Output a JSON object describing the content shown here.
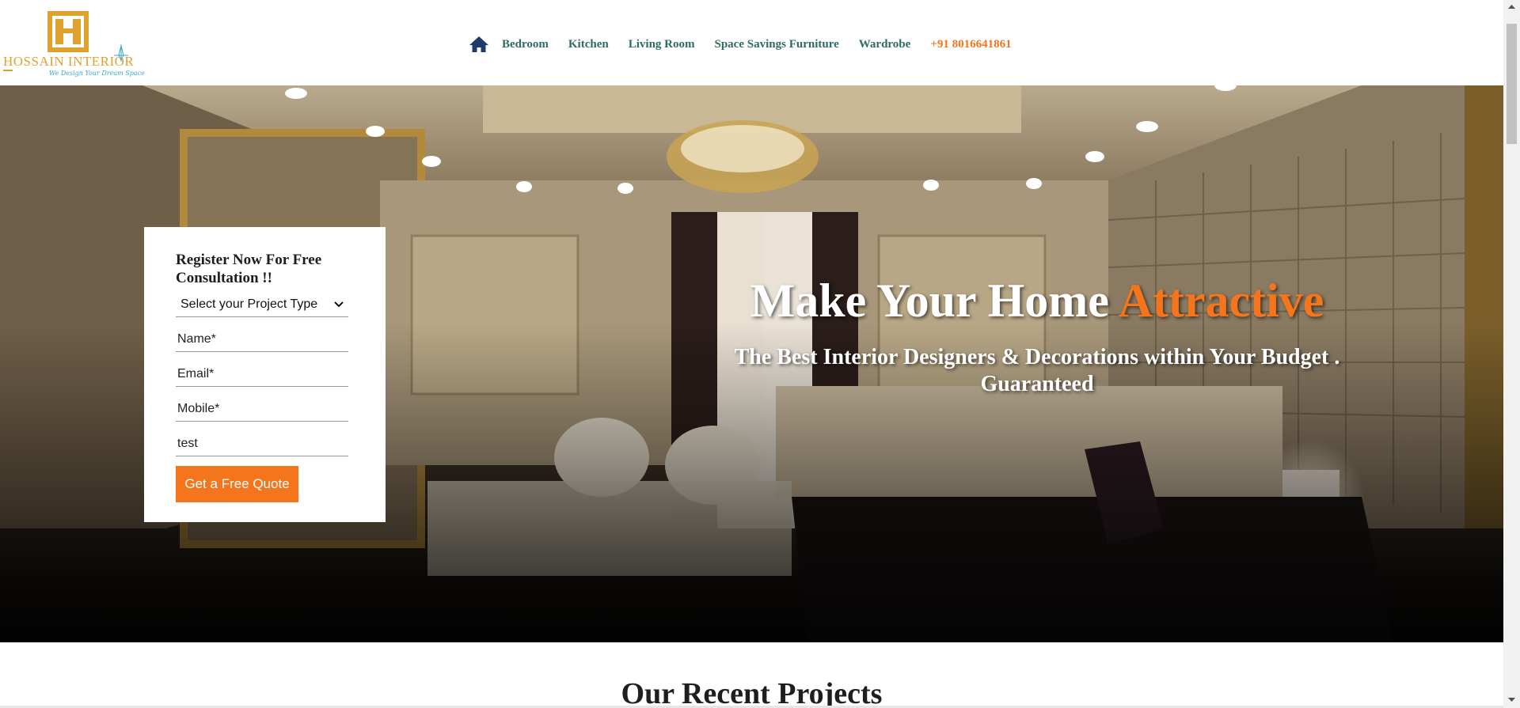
{
  "header": {
    "logo": {
      "name": "HOSSAIN INTERIOR",
      "tagline": "We Design Your Dream Space",
      "icon": "hossain-logo-mark"
    },
    "nav": {
      "home_icon": "home-icon",
      "items": [
        {
          "label": "Bedroom"
        },
        {
          "label": "Kitchen"
        },
        {
          "label": "Living Room"
        },
        {
          "label": "Space Savings Furniture"
        },
        {
          "label": "Wardrobe"
        }
      ],
      "phone": "+91 8016641861"
    }
  },
  "hero": {
    "title_main": "Make Your Home",
    "title_accent": "Attractive",
    "subtitle": "The Best Interior Designers & Decorations within Your Budget . Guaranteed"
  },
  "form": {
    "title": "Register Now For Free Consultation !!",
    "select": {
      "selected": "Select your Project Type",
      "icon": "chevron-down-icon"
    },
    "name_placeholder": "Name*",
    "email_placeholder": "Email*",
    "mobile_placeholder": "Mobile*",
    "message_value": "test",
    "submit_label": "Get a Free Quote"
  },
  "section": {
    "title": "Our Recent Projects"
  },
  "colors": {
    "accent": "#f5751d",
    "nav_text": "#2f6b62",
    "logo_gold": "#e0a22e",
    "home_icon": "#1f3b6b"
  }
}
